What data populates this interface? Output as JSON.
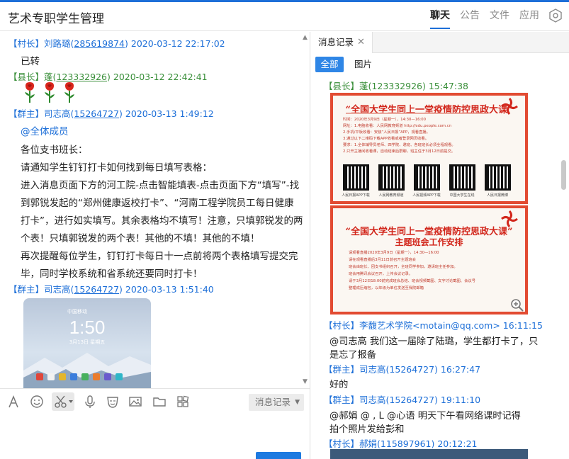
{
  "app": {
    "title": "艺术专职学生管理",
    "nav_tabs": [
      "聊天",
      "公告",
      "文件",
      "应用"
    ],
    "active_tab": "聊天",
    "accent_color": "#1d6fd8"
  },
  "chat": {
    "messages": [
      {
        "tag": "【村长】",
        "name": "刘路璐",
        "uid": "285619874",
        "time": "2020-03-12 22:17:02",
        "lines": [
          "已转"
        ]
      },
      {
        "tag": "【县长】",
        "name": "蓬",
        "uid": "123332926",
        "time": "2020-03-12 22:42:41",
        "lines": []
      },
      {
        "tag": "【群主】",
        "name": "司志高",
        "uid": "15264727",
        "time": "2020-03-13 1:49:12",
        "mention": "@全体成员",
        "lines": [
          "各位支书班长：",
          "请通知学生钉钉打卡如何找到每日填写表格：",
          "进入消息页面下方的河工院-点击智能填表-点击页面下方“填写”-找",
          "到郭锐发起的“郑州健康返校打卡”、“河南工程学院员工每日健康",
          "打卡”，进行如实填写。其余表格均不填写！注意，只填郭锐发的两",
          "个表！只填郭锐发的两个表！其他的不填！其他的不填！",
          "再次提醒每位学生，钉钉打卡每日十一点前将两个表格填写提交完",
          "毕，同时学校系统和省系统还要同时打卡！"
        ]
      },
      {
        "tag": "【群主】",
        "name": "司志高",
        "uid": "15264727",
        "time": "2020-03-13 1:51:40",
        "lines": []
      }
    ],
    "phone_screenshot": {
      "carrier": "中国移动",
      "clock": "1:50",
      "date": "3月13日 星期五"
    }
  },
  "toolbar": {
    "icons": [
      "font-icon",
      "emoji-icon",
      "screenshot-scissors-icon",
      "voice-icon",
      "face-icon",
      "image-icon",
      "folder-icon",
      "apps-icon"
    ],
    "history_label": "消息记录"
  },
  "history_panel": {
    "tab_label": "消息记录",
    "filters": [
      "全部",
      "图片"
    ],
    "active_filter": "全部",
    "messages": [
      {
        "tag": "【县长】",
        "name": "蓬",
        "uid": "(123332926)",
        "time": "15:47:38",
        "lines": []
      },
      {
        "tag": "【村长】",
        "name": "李馥艺术学院",
        "uid": "<motain@qq.com>",
        "time": "16:11:15",
        "lines": [
          "@司志高 我们这一届除了陆璐，学生都打卡了，只",
          "是忘了报备"
        ]
      },
      {
        "tag": "【群主】",
        "name": "司志高",
        "uid": "(15264727)",
        "time": "16:27:47",
        "lines": [
          "好的"
        ]
      },
      {
        "tag": "【群主】",
        "name": "司志高",
        "uid": "(15264727)",
        "time": "19:11:10",
        "lines": [
          "@郝娟 @        , L @心语 明天下午看网络课时记得",
          "拍个照片发给彭和"
        ]
      },
      {
        "tag": "【村长】",
        "name": "郝娟",
        "uid": "(115897961)",
        "time": "20:12:21",
        "lines": []
      }
    ],
    "poster1": {
      "title": "“全国大学生同上一堂疫情防控思政大课”",
      "lines": [
        "时间：2020年3月9日（星期一），14:30—16:00",
        "网址：1.电脑收看：人民网教育频道 http://edu.people.com.cn",
        "2.手机/平板收看：安装“人民日报”APP，观看直播。",
        "3.通过以下二维码下载APP收看或者登录网页收看。",
        "要求：1.全体辅导员老师、四学院、邀班、各班班长必须全程观看。",
        "2.只开主播间收看课，自动结束后群聊，班主任于3月12日前提交。"
      ],
      "qr_labels": [
        "人民日报APP下载",
        "人民网教育频道",
        "人民视频APP下载",
        "中国大学生在线",
        "人民日报微博"
      ]
    },
    "poster2": {
      "title": "“全国大学生同上一堂疫情防控思政大课”",
      "subtitle": "主题班会工作安排",
      "lines": [
        "请观看直播2020年3月9日（星期一），14:30—16:00",
        "请在观看直播后3月11日前召开主题班会",
        "班会由班长、团支书组织召开，全班同学参加，邀请班主任参加。",
        "班会用腾讯会议召开，上传会议记录。",
        "请于3月12日18:00前完成班会总结、班会视频截图、文字讨论截图、会议号",
        "整理成压缩包，以年级为单位发送至我院邮箱"
      ]
    }
  }
}
